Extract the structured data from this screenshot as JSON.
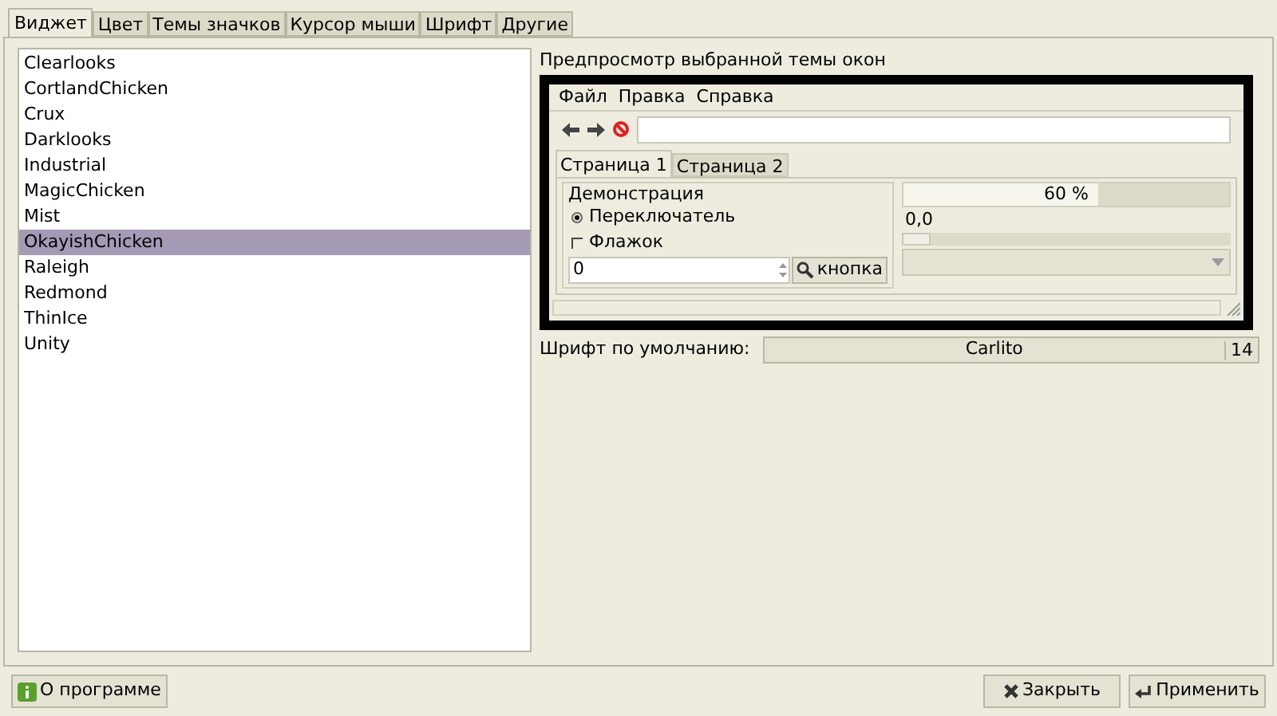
{
  "tabs": [
    {
      "label": "Виджет",
      "selected": true
    },
    {
      "label": "Цвет",
      "selected": false
    },
    {
      "label": "Темы значков",
      "selected": false
    },
    {
      "label": "Курсор мыши",
      "selected": false
    },
    {
      "label": "Шрифт",
      "selected": false
    },
    {
      "label": "Другие",
      "selected": false
    }
  ],
  "themes": [
    {
      "label": "Clearlooks",
      "selected": false
    },
    {
      "label": "CortlandChicken",
      "selected": false
    },
    {
      "label": "Crux",
      "selected": false
    },
    {
      "label": "Darklooks",
      "selected": false
    },
    {
      "label": "Industrial",
      "selected": false
    },
    {
      "label": "MagicChicken",
      "selected": false
    },
    {
      "label": "Mist",
      "selected": false
    },
    {
      "label": "OkayishChicken",
      "selected": true
    },
    {
      "label": "Raleigh",
      "selected": false
    },
    {
      "label": "Redmond",
      "selected": false
    },
    {
      "label": "ThinIce",
      "selected": false
    },
    {
      "label": "Unity",
      "selected": false
    }
  ],
  "preview": {
    "title": "Предпросмотр выбранной темы окон",
    "menu": [
      "Файл",
      "Правка",
      "Справка"
    ],
    "tabs": [
      {
        "label": "Страница 1",
        "selected": true
      },
      {
        "label": "Страница 2",
        "selected": false
      }
    ],
    "group_title": "Демонстрация",
    "radio": {
      "label": "Переключатель",
      "checked": true
    },
    "checkbox": {
      "label": "Флажок",
      "checked": false
    },
    "spin_value": "0",
    "button": "кнопка",
    "progress": {
      "level": 0.6,
      "label": "60 %"
    },
    "scale_value": "0,0",
    "slider": {
      "level": 0.0
    }
  },
  "font": {
    "label": "Шрифт по умолчанию:",
    "name": "Carlito",
    "size": "14"
  },
  "buttons": {
    "about": "О программе",
    "close": "Закрыть",
    "apply": "Применить"
  }
}
